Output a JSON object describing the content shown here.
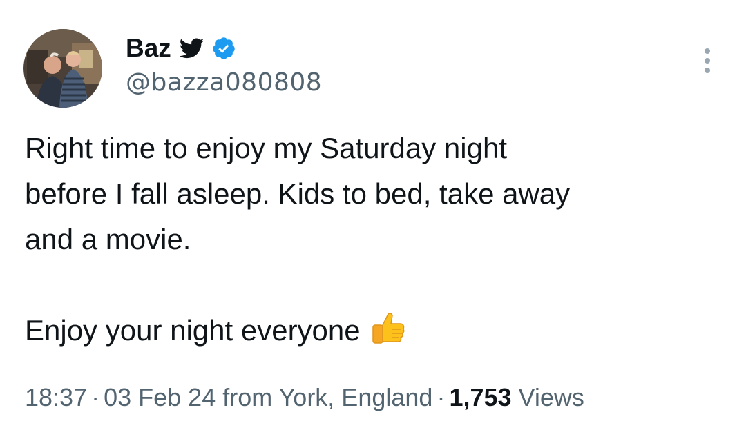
{
  "tweet": {
    "author": {
      "display_name": "Baz",
      "handle": "@bazza080808",
      "verified": true
    },
    "text_lines": [
      "Right time to enjoy my Saturday night",
      "before I fall asleep. Kids to bed, take away",
      "and a movie."
    ],
    "text_last": "Enjoy your night everyone",
    "meta": {
      "time": "18:37",
      "separator": "·",
      "date": "03 Feb 24",
      "location": "from York, England",
      "views_count": "1,753",
      "views_label": "Views"
    }
  },
  "icons": {
    "bird": "twitter-bird-icon",
    "verified": "verified-badge-icon",
    "more": "more-options-icon",
    "thumbs": "thumbs-up-emoji"
  },
  "colors": {
    "text_primary": "#0f1419",
    "text_secondary": "#536471",
    "verified_blue": "#1d9bf0",
    "divider": "#dfe6e9"
  }
}
